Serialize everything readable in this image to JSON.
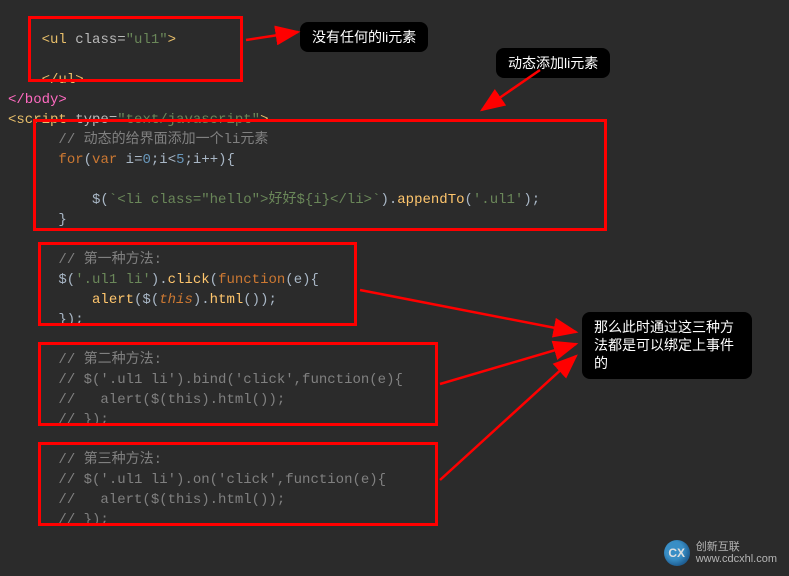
{
  "code": {
    "ul_open": "<ul class=\"ul1\">",
    "ul_close": "</ul>",
    "body_close": "</body>",
    "script_open": "<script type=\"text/javascript\">",
    "comment_dynamic": "// 动态的给界面添加一个li元素",
    "for_line": "for(var i=0;i<5;i++){",
    "append_line_pre": "$(`<li class=\"hello\">好好${i}</li>`).appendTo('.ul1');",
    "for_close": "}",
    "m1_comment": "// 第一种方法:",
    "m1_l1": "$('.ul1 li').click(function(e){",
    "m1_l2": "    alert($(this).html());",
    "m1_l3": "});",
    "m2_comment": "// 第二种方法:",
    "m2_l1": "// $('.ul1 li').bind('click',function(e){",
    "m2_l2": "//   alert($(this).html());",
    "m2_l3": "// });",
    "m3_comment": "// 第三种方法:",
    "m3_l1": "// $('.ul1 li').on('click',function(e){",
    "m3_l2": "//   alert($(this).html());",
    "m3_l3": "// });"
  },
  "annotations": {
    "no_li": "没有任何的li元素",
    "dynamic_add": "动态添加li元素",
    "three_methods": "那么此时通过这三种方法都是可以绑定上事件的"
  },
  "watermark": {
    "logo": "CX",
    "name": "创新互联",
    "url": "www.cdcxhl.com"
  }
}
